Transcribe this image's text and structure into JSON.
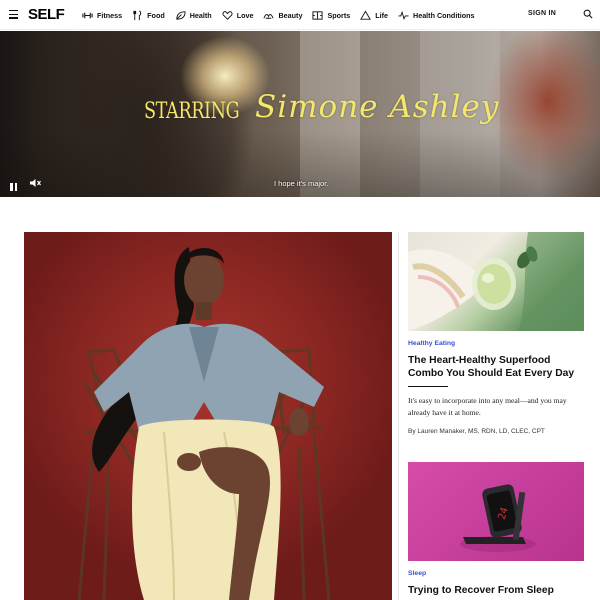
{
  "header": {
    "logo": "SELF",
    "nav": [
      {
        "label": "Fitness",
        "icon": "dumbbell-icon"
      },
      {
        "label": "Food",
        "icon": "fork-knife-icon"
      },
      {
        "label": "Health",
        "icon": "leaf-icon"
      },
      {
        "label": "Love",
        "icon": "heart-icon"
      },
      {
        "label": "Beauty",
        "icon": "beauty-icon"
      },
      {
        "label": "Sports",
        "icon": "sports-icon"
      },
      {
        "label": "Life",
        "icon": "triangle-icon"
      },
      {
        "label": "Health Conditions",
        "icon": "pulse-icon"
      }
    ],
    "sign_in": "SIGN IN"
  },
  "hero": {
    "starring": "STARRING",
    "name": "Simone Ashley",
    "caption": "I hope it's major.",
    "accent_color": "#f4e76a"
  },
  "cards": [
    {
      "kicker": "Healthy Eating",
      "headline": "The Heart-Healthy Superfood Combo You Should Eat Every Day",
      "dek": "It's easy to incorporate into any meal—and you may already have it at home.",
      "byline": "By Lauren Manaker, MS, RDN, LD, CLEC, CPT"
    },
    {
      "kicker": "Sleep",
      "headline": "Trying to Recover From Sleep"
    }
  ],
  "colors": {
    "kicker": "#3a4fd8",
    "feature_bg": "#8a2622"
  }
}
